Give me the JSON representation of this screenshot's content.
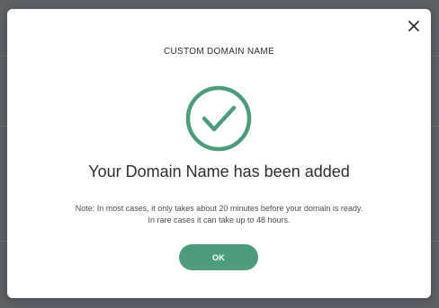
{
  "modal": {
    "header": "CUSTOM DOMAIN NAME",
    "title": "Your Domain Name has been added",
    "note_line1": "Note: In most cases, it only takes about 20 minutes before your domain is ready.",
    "note_line2": "In rare cases it can take up to 48 hours.",
    "ok_label": "OK",
    "close_icon": "close-icon",
    "success_icon": "check-circle-icon"
  },
  "colors": {
    "accent": "#4d9c7c",
    "backdrop": "#5d6166",
    "text": "#2b2f33"
  }
}
